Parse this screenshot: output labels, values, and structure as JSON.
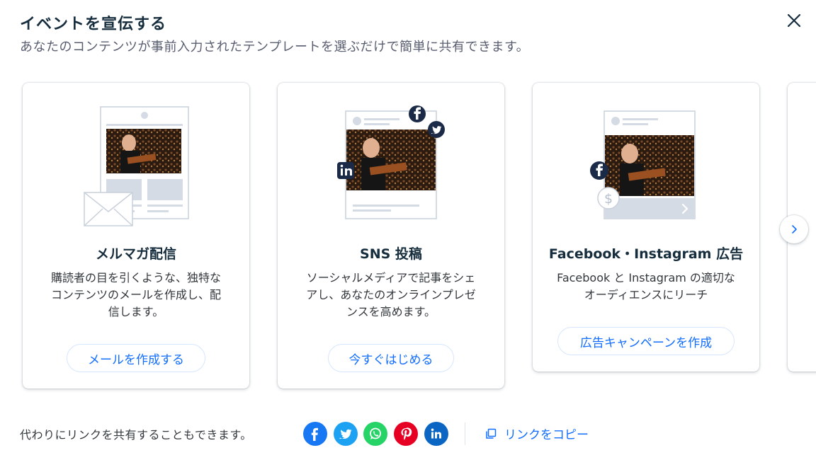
{
  "header": {
    "title": "イベントを宣伝する",
    "subtitle": "あなたのコンテンツが事前入力されたテンプレートを選ぶだけで簡単に共有できます。"
  },
  "cards": [
    {
      "title": "メルマガ配信",
      "description": "購読者の目を引くような、独特なコンテンツのメールを作成し、配信します。",
      "button": "メールを作成する"
    },
    {
      "title": "SNS 投稿",
      "description": "ソーシャルメディアで記事をシェアし、あなたのオンラインプレゼンスを高めます。",
      "button": "今すぐはじめる"
    },
    {
      "title": "Facebook・Instagram 広告",
      "description": "Facebook と Instagram の適切なオーディエンスにリーチ",
      "button": "広告キャンペーンを作成"
    }
  ],
  "footer": {
    "share_text": "代わりにリンクを共有することもできます。",
    "copy_link": "リンクをコピー",
    "social": [
      {
        "name": "facebook-icon",
        "color": "#1877f2"
      },
      {
        "name": "twitter-icon",
        "color": "#1da1f2"
      },
      {
        "name": "whatsapp-icon",
        "color": "#25d366"
      },
      {
        "name": "pinterest-icon",
        "color": "#e60023"
      },
      {
        "name": "linkedin-icon",
        "color": "#0a66c2"
      }
    ]
  },
  "colors": {
    "accent": "#116dff",
    "title": "#162d3d",
    "navy_icon": "#1b2a47"
  }
}
